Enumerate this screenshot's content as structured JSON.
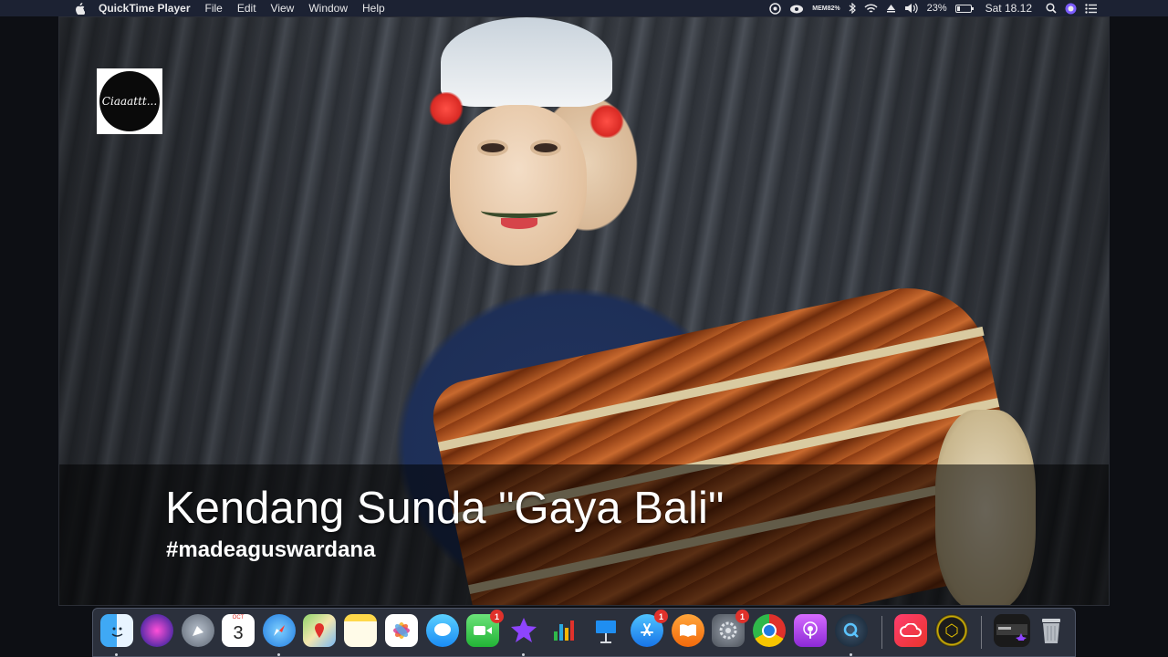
{
  "menubar": {
    "app_name": "QuickTime Player",
    "menus": [
      "File",
      "Edit",
      "View",
      "Window",
      "Help"
    ],
    "mem_label": "MEM",
    "mem_value": "82%",
    "battery_percent": "23%",
    "battery_level": 0.23,
    "clock": "Sat 18.12"
  },
  "video": {
    "logo_text": "Ciaaattt...",
    "caption_title": "Kendang Sunda \"Gaya Bali\"",
    "caption_tag": "#madeaguswardana"
  },
  "dock": {
    "calendar_month": "OCT",
    "calendar_day": "3",
    "badge_count": "1",
    "items": [
      "finder-icon",
      "siri-icon",
      "launchpad-icon",
      "calendar-icon",
      "safari-icon",
      "maps-icon",
      "notes-icon",
      "photos-icon",
      "messages-icon",
      "facetime-icon",
      "imovie-icon",
      "numbers-icon",
      "keynote-icon",
      "app-store-icon",
      "books-icon",
      "system-preferences-icon",
      "chrome-icon",
      "podcasts-icon",
      "quicktime-icon",
      "creative-cloud-icon",
      "photo-app-icon",
      "screen-video-icon",
      "trash-icon"
    ]
  }
}
